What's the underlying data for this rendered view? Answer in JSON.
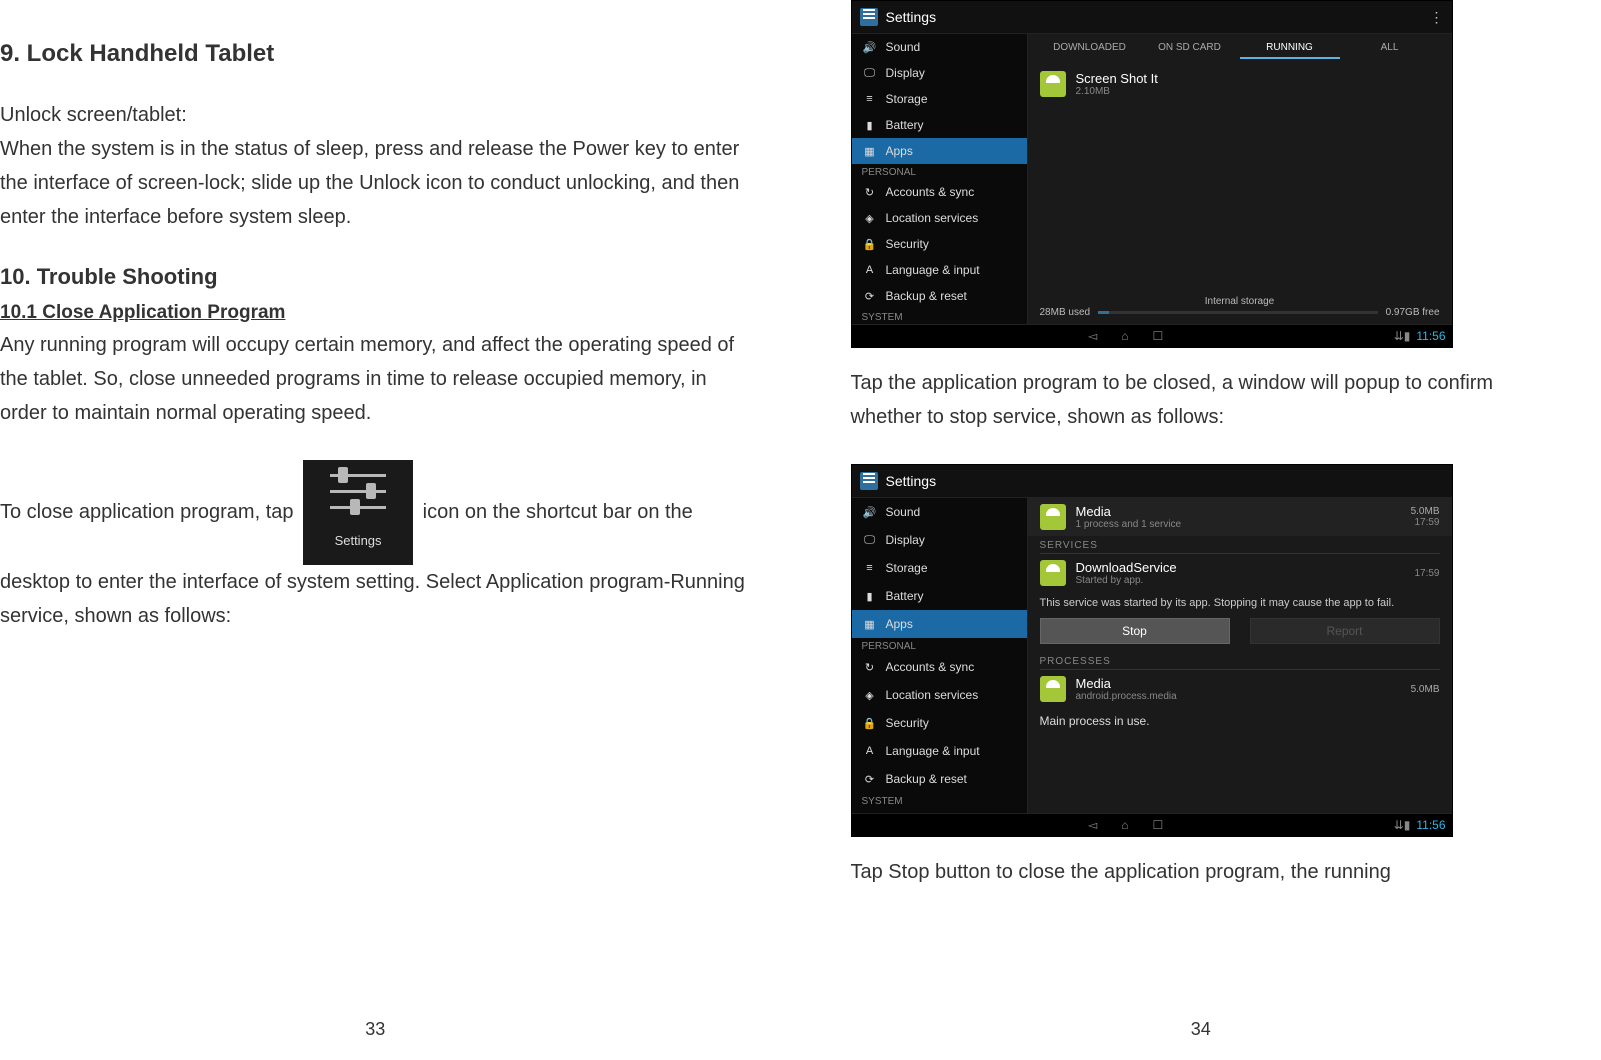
{
  "left": {
    "h9": "9. Lock Handheld Tablet",
    "p9": "Unlock screen/tablet:\nWhen the system is in the status of sleep, press and release the Power key to enter the interface of screen-lock; slide up the Unlock icon to conduct unlocking, and then enter the interface before system sleep.",
    "h10": "10. Trouble Shooting",
    "h10_1": "10.1 Close Application Program",
    "p10_1": "Any running program will occupy certain memory, and affect the operating speed of the tablet. So, close unneeded programs in time to release occupied memory, in order to maintain normal operating speed.",
    "p10_2a": "To close application program, tap ",
    "settings_icon_label": "Settings",
    "p10_2b": " icon on the shortcut bar on the desktop to enter the interface of system setting. Select Application program-Running service, shown as follows:",
    "page_num": "33"
  },
  "right": {
    "p_tap_app": "Tap the application program to be closed, a window will popup to confirm whether to stop service, shown as follows:",
    "p_tap_stop": "Tap Stop button to close the application program, the running",
    "page_num": "34"
  },
  "android_settings": {
    "title": "Settings",
    "menu_icon": "⋮",
    "categories": {
      "personal": "PERSONAL",
      "system": "SYSTEM"
    },
    "items": {
      "sound": "Sound",
      "display": "Display",
      "storage": "Storage",
      "battery": "Battery",
      "apps": "Apps",
      "accounts": "Accounts & sync",
      "location": "Location services",
      "security": "Security",
      "language": "Language & input",
      "backup": "Backup & reset"
    },
    "icons": {
      "sound": "🔊",
      "display": "🖵",
      "storage": "≡",
      "battery": "▮",
      "apps": "▦",
      "accounts": "↻",
      "location": "◈",
      "security": "🔒",
      "language": "A",
      "backup": "⟳"
    }
  },
  "shot1": {
    "tabs": {
      "downloaded": "DOWNLOADED",
      "sd": "ON SD CARD",
      "running": "RUNNING",
      "all": "ALL"
    },
    "app": {
      "name": "Screen Shot It",
      "sub": "2.10MB"
    },
    "storage": {
      "used": "28MB used",
      "label": "Internal storage",
      "free": "0.97GB free",
      "fill_pct": 4
    },
    "clock": "11:56"
  },
  "shot2": {
    "media_top": {
      "name": "Media",
      "sub": "1 process and 1 service",
      "right_top": "5.0MB",
      "right_sub": "17:59"
    },
    "sections": {
      "services": "SERVICES",
      "processes": "PROCESSES"
    },
    "service": {
      "name": "DownloadService",
      "sub": "Started by app.",
      "time": "17:59"
    },
    "service_note": "This service was started by its app. Stopping it may cause the app to fail.",
    "buttons": {
      "stop": "Stop",
      "report": "Report"
    },
    "process": {
      "name": "Media",
      "sub": "android.process.media",
      "right": "5.0MB"
    },
    "main_process": "Main process in use.",
    "clock": "11:56"
  }
}
